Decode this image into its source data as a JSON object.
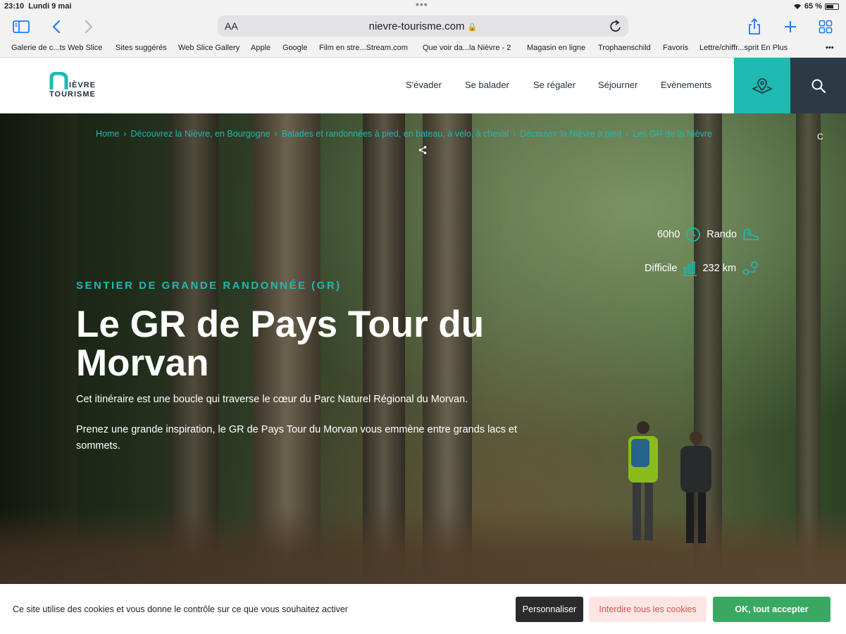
{
  "status_bar": {
    "time": "23:10",
    "date": "Lundi 9 mai",
    "battery": "65 %",
    "battery_level": 0.65
  },
  "toolbar": {
    "aa_label": "AA",
    "domain": "nievre-tourisme.com"
  },
  "bookmarks": [
    "Galerie de c...ts Web Slice",
    "Sites suggérés",
    "Web Slice Gallery",
    "Apple",
    "Google",
    "Film en stre...Stream.com",
    "Que voir da...la Nièvre - 2",
    "Magasin en ligne",
    "Trophaenschild",
    "Favoris",
    "Lettre/chiffr...sprit En Plus"
  ],
  "site": {
    "logo": {
      "ievre": "IÈVRE",
      "tourisme": "TOURISME"
    },
    "nav": [
      "S'évader",
      "Se balader",
      "Se régaler",
      "Séjourner",
      "Evènements"
    ]
  },
  "hero": {
    "breadcrumbs": [
      "Home",
      "Découvrez la Nièvre, en Bourgogne",
      "Balades et randonnées à pied, en bateau, à vélo, à cheval",
      "Découvrir la Nièvre à pied",
      "Les GR de la Nièvre"
    ],
    "corner": "C",
    "duration": "60h0",
    "activity": "Rando",
    "difficulty": "Difficile",
    "distance": "232 km",
    "kicker": "SENTIER DE GRANDE RANDONNÉE (GR)",
    "title": "Le GR de Pays Tour du Morvan",
    "lead1": "Cet itinéraire est une boucle qui traverse le cœur du Parc Naturel Régional du Morvan.",
    "lead2": "Prenez une grande inspiration, le GR de Pays Tour du Morvan vous emmène entre grands lacs et sommets."
  },
  "cookie": {
    "message": "Ce site utilise des cookies et vous donne le contrôle sur ce que vous souhaitez activer",
    "personalize": "Personnaliser",
    "deny_all": "Interdire tous les cookies",
    "accept_all": "OK, tout accepter"
  },
  "colors": {
    "teal": "#1ebab1",
    "dark_navy": "#2b3a45",
    "ios_blue": "#1a7cf5",
    "accept_green": "#3aa862"
  }
}
